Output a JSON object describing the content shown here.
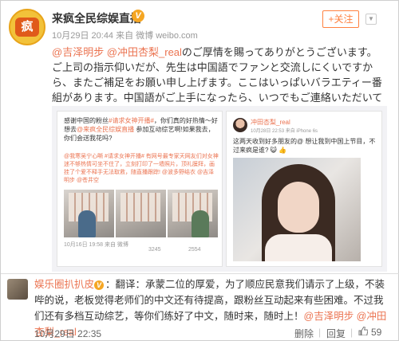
{
  "post": {
    "account_name": "来疯全民综娱直播",
    "follow_label": "+关注",
    "meta": "10月29日 20:44 来自 微博 weibo.com",
    "text_mentions": "@吉泽明步 @冲田杏梨_real",
    "text_body": "のご厚情を賜ってありがとうございます。ご上司の指示仰いだが、先生は中国語でファンと交流しにくいですから、またご補足をお願い申し上げます。ここはいっぱいバラエティー番組があります。中国語がご上手になったら、いつでもご連絡いただいて幸いです。"
  },
  "quote1": {
    "text_pre": "感谢中国的粉丝",
    "text_link": "#请求女神开播#",
    "text_mid": "，你们真的好热情～好想去",
    "text_mention": "@来疯全民综娱直播",
    "text_post": " 参加互动综艺啊!如果我去，你们会送我花吗?",
    "sub": "@我寒吴宁心嘶 #请求女神开播# 有网号最专家天网友们对女神迷不够热情可坐不住了，立刻打印了一墙照片，顶礼膜拜，画挂了个爱不释手无法取救，随直播跟踪! @波多野结衣 @吉泽明步 @苍井空",
    "date": "10月16日 19:58 来自 微博",
    "count_comment": "3245",
    "count_like": "2554"
  },
  "quote2": {
    "name": "冲田杏梨_real",
    "meta": "10月28日 22:53 来自 iPhone 6s",
    "text": "这两天收到好多朋友的@ 想让我到中国上节目，不过来疯是谁? 😺 👍"
  },
  "comment": {
    "author": "娱乐圈扒扒皮",
    "body": "：翻译：承蒙二位的厚爱，为了顺应民意我们请示了上级，不装哔的说，老板觉得老师们的中文还有待提高，跟粉丝互动起来有些困难。不过我们还有多档互动综艺，等你们练好了中文，随时来，随时上！",
    "mentions": "@吉泽明步 @冲田杏梨_real",
    "time": "10月29日 22:35",
    "delete_label": "删除",
    "reply_label": "回复",
    "like_count": "59"
  },
  "colors": {
    "link": "#eb7350",
    "verified": "#f5a623",
    "follow": "#ff8140"
  },
  "icons": [
    "verified-badge-icon",
    "chevron-down-icon",
    "thumbs-up-icon"
  ]
}
